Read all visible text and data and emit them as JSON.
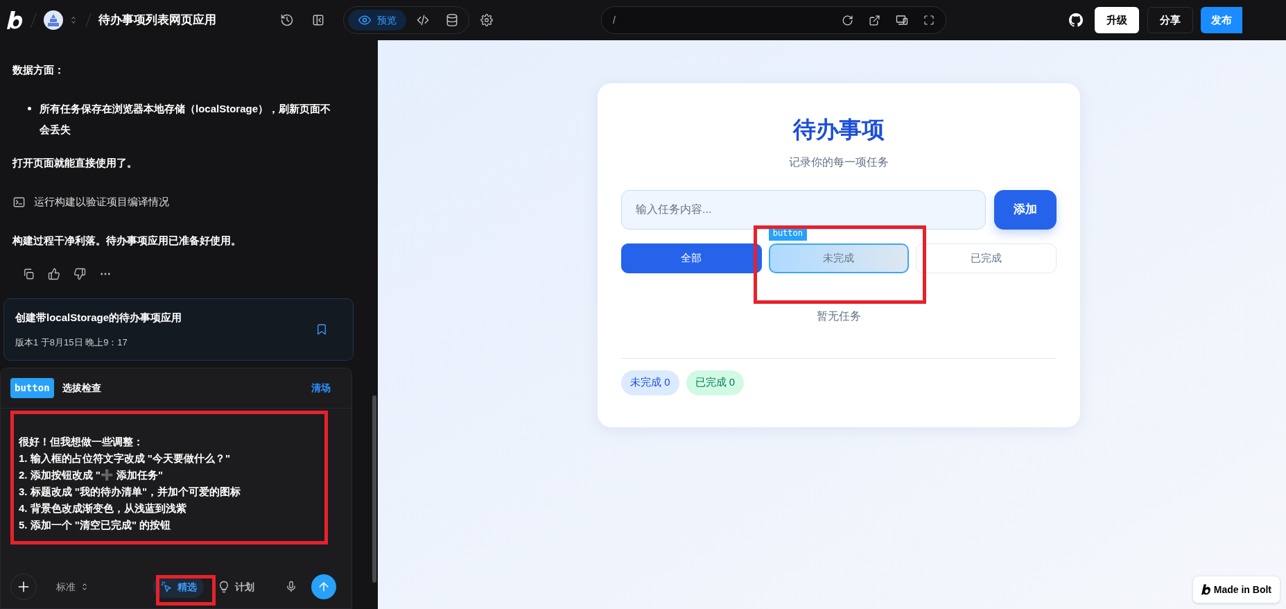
{
  "topbar": {
    "title": "待办事项列表网页应用",
    "view_tabs": [
      {
        "kind": "preview",
        "label": "预览",
        "selected": true
      },
      {
        "kind": "code",
        "selected": false
      },
      {
        "kind": "database",
        "selected": false
      }
    ],
    "url": "/",
    "buttons": [
      {
        "label": "升级",
        "kind": "light"
      },
      {
        "label": "分享",
        "kind": "dark"
      },
      {
        "label": "发布",
        "kind": "primary"
      }
    ]
  },
  "chat": {
    "messages": [
      {
        "kind": "heading",
        "text": "数据方面："
      },
      {
        "kind": "bullet",
        "text": "所有任务保存在浏览器本地存储（localStorage），刷新页面不会丢失"
      },
      {
        "kind": "para",
        "text": "打开页面就能直接使用了。"
      },
      {
        "kind": "action",
        "text": "运行构建以验证项目编译情况"
      },
      {
        "kind": "para",
        "text": "构建过程干净利落。待办事项应用已准备好使用。"
      }
    ],
    "version_card": {
      "title": "创建带localStorage的待办事项应用",
      "meta": "版本1 于8月15日 晚上9：17"
    },
    "composer": {
      "element_tag": "button",
      "element_label": "选拔检查",
      "clear": "清场",
      "lines": [
        "很好！但我想做一些调整：",
        "1. 输入框的占位符文字改成 \"今天要做什么？\"",
        "2. 添加按钮改成 \"➕ 添加任务\"",
        "3. 标题改成 \"我的待办清单\"，并加个可爱的图标",
        "4. 背景色改成渐变色，从浅蓝到浅紫",
        "5. 添加一个 \"清空已完成\" 的按钮"
      ],
      "mode": "标准",
      "tools": [
        {
          "kind": "select",
          "label": "精选",
          "selected": true
        },
        {
          "kind": "plan",
          "label": "计划",
          "selected": false
        }
      ]
    }
  },
  "preview": {
    "title": "待办事项",
    "subtitle": "记录你的每一项任务",
    "placeholder": "输入任务内容...",
    "add_button": "添加",
    "inspector_tag": "button",
    "filters": [
      {
        "label": "全部",
        "selected": true,
        "inspected": false
      },
      {
        "label": "未完成",
        "selected": false,
        "inspected": true
      },
      {
        "label": "已完成",
        "selected": false,
        "inspected": false
      }
    ],
    "empty": "暂无任务",
    "stats": [
      {
        "kind": "pending",
        "label": "未完成 0"
      },
      {
        "kind": "done",
        "label": "已完成 0"
      }
    ],
    "badge": "Made in Bolt"
  }
}
